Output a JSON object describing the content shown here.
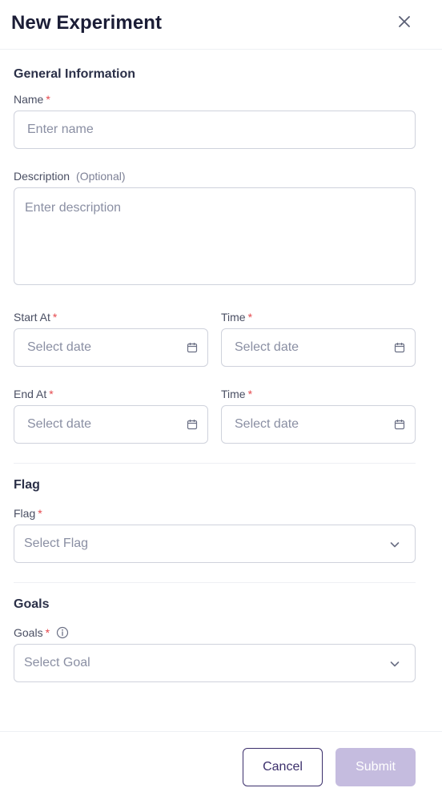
{
  "header": {
    "title": "New Experiment",
    "close_icon": "close-icon"
  },
  "general": {
    "title": "General Information",
    "name_label": "Name",
    "name_placeholder": "Enter name",
    "description_label": "Description",
    "description_optional": "(Optional)",
    "description_placeholder": "Enter description",
    "start_label": "Start At",
    "start_time_label": "Time",
    "end_label": "End At",
    "end_time_label": "Time",
    "date_placeholder": "Select date",
    "required_mark": "*"
  },
  "flag": {
    "title": "Flag",
    "label": "Flag",
    "placeholder": "Select Flag"
  },
  "goals": {
    "title": "Goals",
    "label": "Goals",
    "placeholder": "Select Goal"
  },
  "footer": {
    "cancel_label": "Cancel",
    "submit_label": "Submit"
  },
  "colors": {
    "primary": "#3b2f6b",
    "submit_disabled": "#c5bcdf",
    "required": "#e5484d",
    "border": "#cfd2dc",
    "placeholder": "#8a8fa3"
  }
}
